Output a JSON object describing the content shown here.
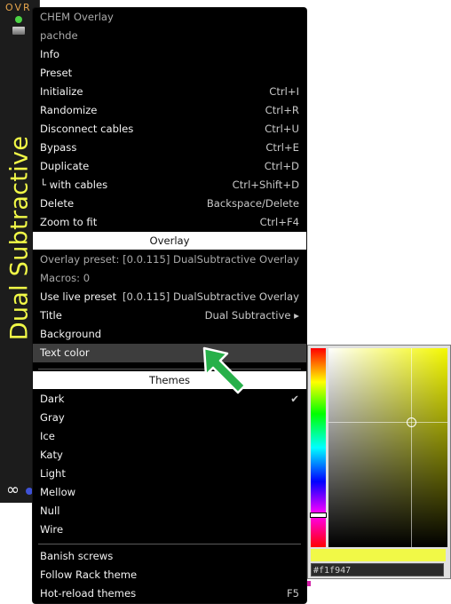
{
  "module": {
    "brand": "OVR",
    "title": "Dual Subtractive",
    "infinity_glyph": "∞",
    "title_color": "#f1f947"
  },
  "menu": {
    "top_items": [
      {
        "label": "CHEM Overlay",
        "right": "",
        "dim": true
      },
      {
        "label": "pachde",
        "right": "",
        "dim": true
      },
      {
        "label": "Info",
        "right": "▸",
        "arrow": true
      },
      {
        "label": "Preset",
        "right": "▸",
        "arrow": true
      },
      {
        "label": "Initialize",
        "right": "Ctrl+I"
      },
      {
        "label": "Randomize",
        "right": "Ctrl+R"
      },
      {
        "label": "Disconnect cables",
        "right": "Ctrl+U"
      },
      {
        "label": "Bypass",
        "right": "Ctrl+E"
      },
      {
        "label": "Duplicate",
        "right": "Ctrl+D"
      },
      {
        "label": "└ with cables",
        "right": "Ctrl+Shift+D"
      },
      {
        "label": "Delete",
        "right": "Backspace/Delete"
      },
      {
        "label": "Zoom to fit",
        "right": "Ctrl+F4"
      }
    ],
    "overlay_header": "Overlay",
    "overlay_items": [
      {
        "label": "Overlay preset: [0.0.115] DualSubtractive Overlay",
        "right": "",
        "dim": true
      },
      {
        "label": "Macros: 0",
        "right": "",
        "dim": true
      },
      {
        "label": "Use live preset",
        "right": "[0.0.115] DualSubtractive Overlay"
      },
      {
        "label": "Title",
        "right": "Dual Subtractive ▸"
      },
      {
        "label": "Background",
        "right": "▸",
        "arrow": true
      },
      {
        "label": "Text color",
        "right": "▸",
        "arrow": true,
        "highlight": true
      }
    ],
    "themes_header": "Themes",
    "theme_items": [
      {
        "label": "Dark",
        "right": "✔"
      },
      {
        "label": "Gray",
        "right": ""
      },
      {
        "label": "Ice",
        "right": ""
      },
      {
        "label": "Katy",
        "right": ""
      },
      {
        "label": "Light",
        "right": ""
      },
      {
        "label": "Mellow",
        "right": ""
      },
      {
        "label": "Null",
        "right": ""
      },
      {
        "label": "Wire",
        "right": ""
      }
    ],
    "bottom_items": [
      {
        "label": "Banish screws",
        "right": ""
      },
      {
        "label": "Follow Rack theme",
        "right": ""
      },
      {
        "label": "Hot-reload themes",
        "right": "F5"
      }
    ]
  },
  "picker": {
    "hex_value": "#f1f947",
    "current_color": "#f1f947"
  }
}
